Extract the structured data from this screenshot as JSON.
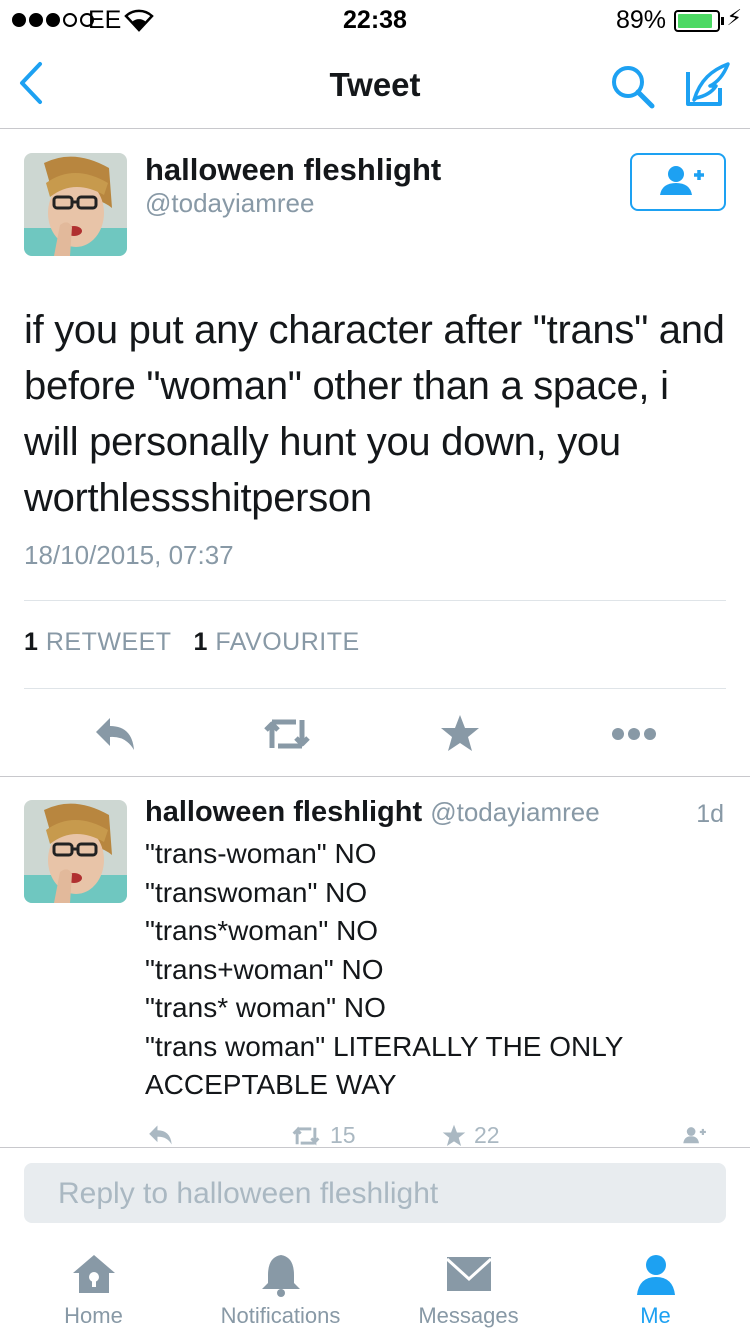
{
  "status_bar": {
    "carrier": "EE",
    "time": "22:38",
    "battery_percent": "89%",
    "battery_level": 0.89,
    "signal_bars": 3
  },
  "nav": {
    "title": "Tweet",
    "back_icon": "chevron-left-icon",
    "search_icon": "search-icon",
    "compose_icon": "compose-icon"
  },
  "main_tweet": {
    "name": "halloween fleshlight",
    "handle": "@todayiamree",
    "text": "if you put any character after \"trans\" and before \"woman\" other than a space, i will personally hunt you down, you worthlessshitperson",
    "timestamp": "18/10/2015, 07:37",
    "retweet_count": "1",
    "retweet_label": "RETWEET",
    "favourite_count": "1",
    "favourite_label": "FAVOURITE"
  },
  "reply_tweet": {
    "name": "halloween fleshlight",
    "handle": "@todayiamree",
    "age": "1d",
    "lines": [
      "\"trans-woman\" NO",
      "\"transwoman\" NO",
      "\"trans*woman\" NO",
      "\"trans+woman\" NO",
      "\"trans* woman\" NO",
      "\"trans woman\" LITERALLY THE ONLY",
      "ACCEPTABLE WAY"
    ],
    "retweets": "15",
    "favourites": "22"
  },
  "reply_box": {
    "placeholder": "Reply to halloween fleshlight"
  },
  "tab_bar": {
    "tabs": [
      {
        "label": "Home",
        "icon": "home-icon"
      },
      {
        "label": "Notifications",
        "icon": "bell-icon"
      },
      {
        "label": "Messages",
        "icon": "envelope-icon"
      },
      {
        "label": "Me",
        "icon": "person-icon"
      }
    ],
    "active": "Me"
  },
  "colors": {
    "accent": "#1da1f2",
    "muted": "#8899a6",
    "text": "#14171a",
    "action_grey": "#8899a6",
    "battery_green": "#4cd964"
  }
}
